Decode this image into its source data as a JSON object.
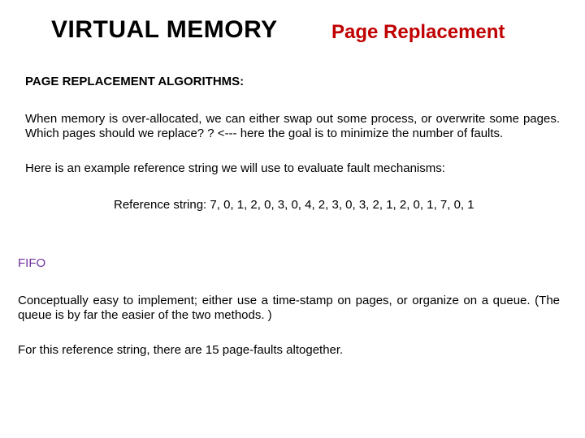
{
  "header": {
    "title_left": "VIRTUAL MEMORY",
    "title_right": "Page Replacement"
  },
  "section_heading": "PAGE REPLACEMENT ALGORITHMS:",
  "paragraphs": {
    "p1": "When memory is over-allocated, we can either swap out some process, or overwrite some pages. Which pages should we replace? ? <--- here the goal is to minimize the number of faults.",
    "p2": "Here is an example reference string we will use to evaluate fault mechanisms:",
    "reference_string": "Reference string: 7, 0, 1, 2, 0, 3, 0, 4, 2, 3, 0, 3, 2, 1, 2, 0, 1, 7, 0, 1",
    "fifo_heading": "FIFO",
    "p3": "Conceptually easy to implement; either use a time-stamp on pages, or organize on a queue.  (The queue is by far the easier of the two methods. )",
    "p4": "For this reference string, there are 15 page-faults altogether."
  }
}
